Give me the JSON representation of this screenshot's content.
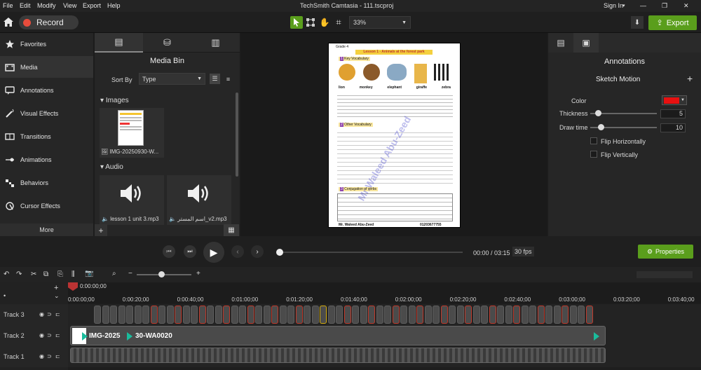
{
  "menu": {
    "file": "File",
    "edit": "Edit",
    "modify": "Modify",
    "view": "View",
    "export": "Export",
    "help": "Help"
  },
  "window": {
    "title": "TechSmith Camtasia - 111.tscproj",
    "sign_in": "Sign In"
  },
  "toolbar": {
    "record_label": "Record",
    "zoom": "33%",
    "export_label": "Export"
  },
  "leftnav": [
    {
      "label": "Favorites",
      "icon": "star-icon"
    },
    {
      "label": "Media",
      "icon": "media-icon"
    },
    {
      "label": "Annotations",
      "icon": "annotation-icon"
    },
    {
      "label": "Visual Effects",
      "icon": "wand-icon"
    },
    {
      "label": "Transitions",
      "icon": "transition-icon"
    },
    {
      "label": "Animations",
      "icon": "animation-icon"
    },
    {
      "label": "Behaviors",
      "icon": "behaviors-icon"
    },
    {
      "label": "Cursor Effects",
      "icon": "cursor-icon"
    }
  ],
  "more_label": "More",
  "bin": {
    "title": "Media Bin",
    "sort_by": "Sort By",
    "sort_value": "Type",
    "images_header": "Images",
    "audio_header": "Audio",
    "image_item": "IMG-20250930-W...",
    "audio_items": [
      "lesson 1 unit 3.mp3",
      "اسم المستر_v2.mp3"
    ]
  },
  "preview_doc": {
    "grade": "Grade 4",
    "lesson": "Lesson 1 - Animals at the forest park",
    "key_vocab": "Key Vocabulary",
    "animals": [
      "lion",
      "monkey",
      "elephant",
      "giraffe",
      "zebra"
    ],
    "other_vocab": "Other Vocabulary",
    "conjugation": "Conjugation of verbs",
    "teacher": "Mr. Waleed Abu-Zeed",
    "phone": "01203677755",
    "watermark": "Mr.Waleed Abu-Zeed"
  },
  "right": {
    "header": "Annotations",
    "sketch": "Sketch Motion",
    "color_label": "Color",
    "color_value": "#e81010",
    "thickness_label": "Thickness",
    "thickness": "5",
    "thickness_level": 0.07,
    "draw_label": "Draw time",
    "draw_time": "10",
    "draw_level": 0.12,
    "flip_h": "Flip Horizontally",
    "flip_v": "Flip Vertically"
  },
  "playback": {
    "time": "00:00 / 03:15",
    "fps": "30 fps",
    "properties": "Properties",
    "progress": 0.0
  },
  "timeline": {
    "playhead": "0:00:00;00",
    "ticks": [
      "0:00:00;00",
      "0:00:20;00",
      "0:00:40;00",
      "0:01:00;00",
      "0:01:20;00",
      "0:01:40;00",
      "0:02:00;00",
      "0:02:20;00",
      "0:02:40;00",
      "0:03:00;00",
      "0:03:20;00",
      "0:03:40;00"
    ],
    "tracks": [
      "Track 3",
      "Track 2",
      "Track 1"
    ],
    "clip_label": "IMG-2025",
    "clip_label2": "30-WA0020"
  },
  "colors": {
    "accent": "#5a9e1c",
    "record": "#e74c3c",
    "selected_tool": "#5a9e1c"
  }
}
